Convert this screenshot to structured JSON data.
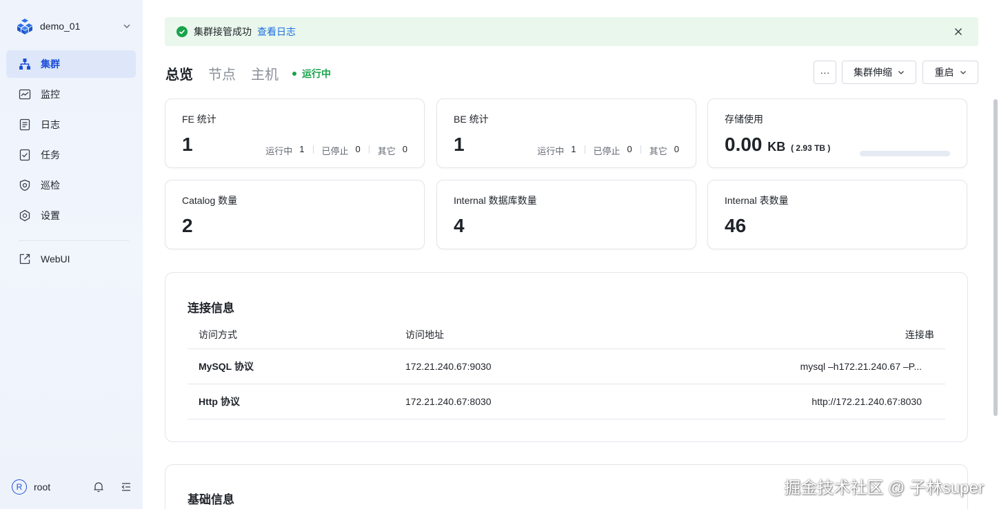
{
  "sidebar": {
    "cluster_name": "demo_01",
    "items": [
      {
        "label": "集群",
        "icon": "cluster-icon",
        "active": true
      },
      {
        "label": "监控",
        "icon": "monitor-icon"
      },
      {
        "label": "日志",
        "icon": "log-icon"
      },
      {
        "label": "任务",
        "icon": "task-icon"
      },
      {
        "label": "巡检",
        "icon": "inspect-icon"
      },
      {
        "label": "设置",
        "icon": "gear-icon"
      }
    ],
    "webui_label": "WebUI",
    "user": {
      "initial": "R",
      "name": "root"
    }
  },
  "alert": {
    "message": "集群接管成功",
    "link": "查看日志"
  },
  "tabs": [
    "总览",
    "节点",
    "主机"
  ],
  "status": "运行中",
  "actions": {
    "more": "···",
    "scale": "集群伸缩",
    "restart": "重启"
  },
  "cards": {
    "fe": {
      "title": "FE 统计",
      "value": "1",
      "running_label": "运行中",
      "running": "1",
      "stopped_label": "已停止",
      "stopped": "0",
      "other_label": "其它",
      "other": "0"
    },
    "be": {
      "title": "BE 统计",
      "value": "1",
      "running_label": "运行中",
      "running": "1",
      "stopped_label": "已停止",
      "stopped": "0",
      "other_label": "其它",
      "other": "0"
    },
    "storage": {
      "title": "存储使用",
      "value": "0.00",
      "unit": "KB",
      "total": "( 2.93 TB )",
      "used_fraction": 0
    },
    "catalog": {
      "title": "Catalog 数量",
      "value": "2"
    },
    "internal_db": {
      "title": "Internal 数据库数量",
      "value": "4"
    },
    "internal_table": {
      "title": "Internal 表数量",
      "value": "46"
    }
  },
  "connection": {
    "title": "连接信息",
    "headers": [
      "访问方式",
      "访问地址",
      "连接串"
    ],
    "rows": [
      {
        "method": "MySQL 协议",
        "address": "172.21.240.67:9030",
        "conn": "mysql –h172.21.240.67 –P..."
      },
      {
        "method": "Http 协议",
        "address": "172.21.240.67:8030",
        "conn": "http://172.21.240.67:8030"
      }
    ]
  },
  "basic": {
    "title": "基础信息"
  },
  "watermark": "掘金技术社区 @ 子林super",
  "colors": {
    "accent": "#1d4ed8",
    "success": "#18a34a",
    "alert_bg": "#e9f7ec",
    "link": "#1d6fe0"
  }
}
